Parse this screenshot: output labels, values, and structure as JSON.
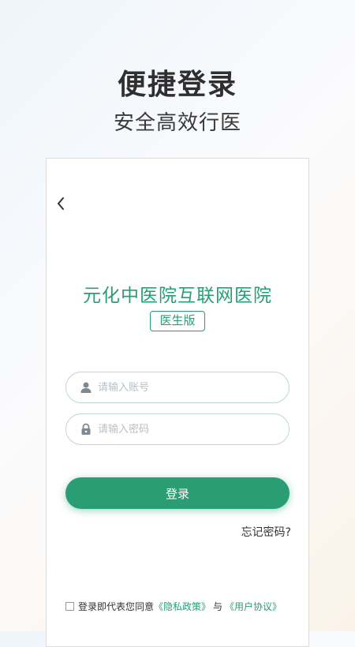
{
  "hero": {
    "title": "便捷登录",
    "subtitle": "安全高效行医"
  },
  "card": {
    "hospital_name": "元化中医院互联网医院",
    "edition_badge": "医生版",
    "account_placeholder": "请输入账号",
    "account_value": "",
    "password_placeholder": "请输入密码",
    "password_value": "",
    "login_label": "登录",
    "forgot_label": "忘记密码?",
    "agreement": {
      "checked": false,
      "prefix": "登录即代表您同意",
      "privacy_link": "《隐私政策》",
      "joiner": "与",
      "terms_link": "《用户协议》"
    }
  },
  "icons": {
    "back": "chevron-left-icon",
    "account": "user-icon",
    "password": "lock-icon"
  },
  "colors": {
    "accent": "#2a9d74",
    "placeholder": "#b8c0c6"
  }
}
